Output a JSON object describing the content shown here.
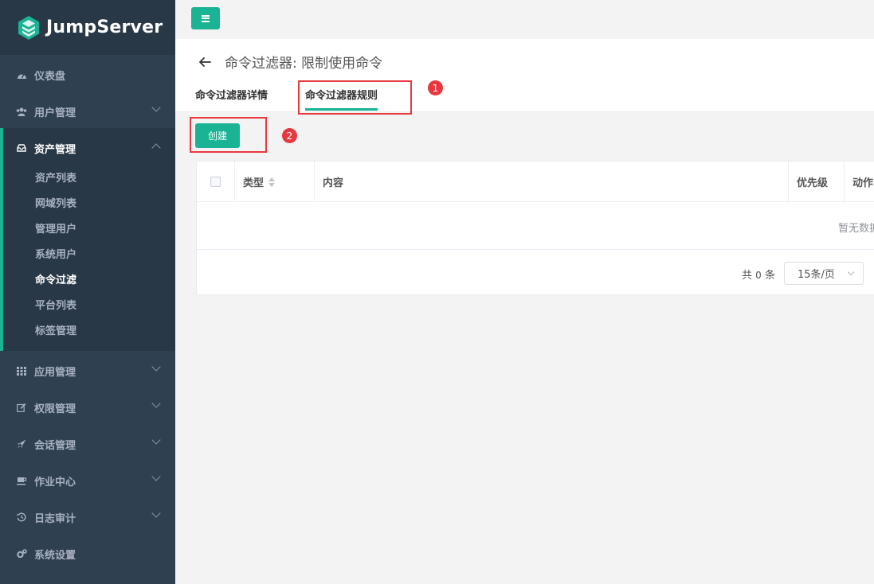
{
  "app": {
    "brand": "JumpServer"
  },
  "sidebar": {
    "items": [
      {
        "label": "仪表盘",
        "icon": "dashboard-icon"
      },
      {
        "label": "用户管理",
        "icon": "users-icon"
      },
      {
        "label": "资产管理",
        "icon": "inbox-icon"
      },
      {
        "label": "应用管理",
        "icon": "grid-icon"
      },
      {
        "label": "权限管理",
        "icon": "edit-icon"
      },
      {
        "label": "会话管理",
        "icon": "rocket-icon"
      },
      {
        "label": "作业中心",
        "icon": "coffee-icon"
      },
      {
        "label": "日志审计",
        "icon": "history-icon"
      },
      {
        "label": "系统设置",
        "icon": "gears-icon"
      }
    ],
    "asset_sub": [
      "资产列表",
      "网域列表",
      "管理用户",
      "系统用户",
      "命令过滤",
      "平台列表",
      "标签管理"
    ],
    "active_sub": "命令过滤"
  },
  "page": {
    "title": "命令过滤器: 限制使用命令",
    "tabs": [
      {
        "label": "命令过滤器详情"
      },
      {
        "label": "命令过滤器规则"
      }
    ]
  },
  "annotations": {
    "badge1": "1",
    "badge2": "2"
  },
  "toolbar": {
    "create_label": "创建"
  },
  "table": {
    "columns": [
      "类型",
      "内容",
      "优先级",
      "动作"
    ],
    "empty_text": "暂无数据"
  },
  "pagination": {
    "total_prefix": "共",
    "total_count": "0",
    "total_suffix": "条",
    "page_size": "15条/页"
  },
  "colors": {
    "accent": "#1ab394",
    "sidebar": "#2f4050",
    "annotation": "#e8393e"
  }
}
